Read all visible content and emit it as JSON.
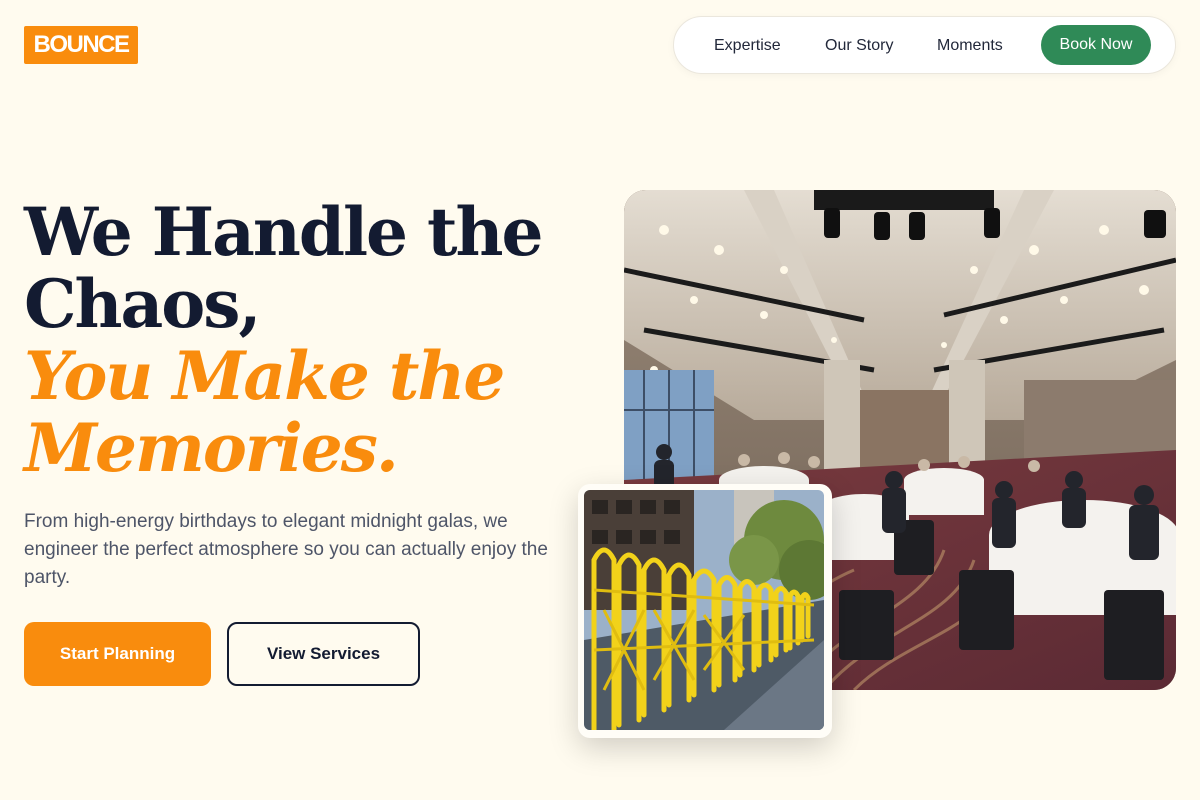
{
  "logo": {
    "text": "BOUNCE"
  },
  "nav": {
    "links": [
      "Expertise",
      "Our Story",
      "Moments"
    ],
    "cta": "Book Now"
  },
  "hero": {
    "headline_line1": "We Handle the",
    "headline_line2": "Chaos,",
    "headline_accent1": "You Make the",
    "headline_accent2": "Memories.",
    "subtext": "From high-energy birthdays to elegant midnight galas, we engineer the perfect atmosphere so you can actually enjoy the party.",
    "primary_cta": "Start Planning",
    "secondary_cta": "View Services"
  },
  "colors": {
    "background": "#fffbef",
    "accent": "#f98c0d",
    "dark": "#131b31",
    "nav_cta": "#2f8a57"
  }
}
